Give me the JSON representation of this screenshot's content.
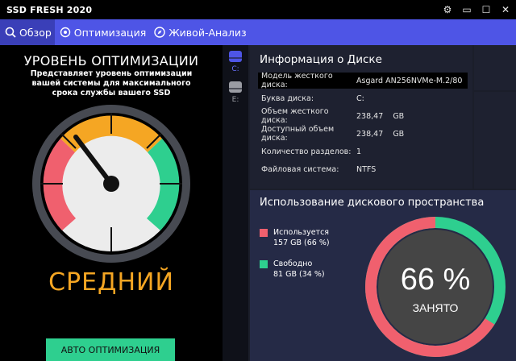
{
  "app": {
    "title": "SSD FRESH 2020"
  },
  "tabs": [
    {
      "label": "Обзор",
      "icon": "search-icon",
      "active": true
    },
    {
      "label": "Оптимизация",
      "icon": "gear-icon",
      "active": false
    },
    {
      "label": "Живой-Анализ",
      "icon": "compass-icon",
      "active": false
    }
  ],
  "optimization": {
    "heading": "УРОВЕНЬ ОПТИМИЗАЦИИ",
    "description": "Представляет уровень оптимизации вашей системы для максимального срока службы вашего SSD",
    "level": "СРЕДНИЙ",
    "button": "АВТО ОПТИМИЗАЦИЯ"
  },
  "drives": [
    {
      "letter": "C:",
      "selected": true
    },
    {
      "letter": "E:",
      "selected": false
    }
  ],
  "disk_info": {
    "heading": "Информация о Диске",
    "rows": [
      {
        "key": "Модель жесткого диска:",
        "value": "Asgard AN256NVMe-M.2/80"
      },
      {
        "key": "Буква диска:",
        "value": "C:"
      },
      {
        "key": "Объем жесткого диска:",
        "value": "238,47    GB"
      },
      {
        "key": "Доступный объем диска:",
        "value": "238,47    GB"
      },
      {
        "key": "Количество разделов:",
        "value": "1"
      },
      {
        "key": "Файловая система:",
        "value": "NTFS"
      }
    ]
  },
  "usage": {
    "heading": "Использование дискового пространства",
    "used_label": "Используется",
    "used_value": "157 GB (66 %)",
    "free_label": "Свободно",
    "free_value": "81 GB (34 %)",
    "percent_text": "66 %",
    "status_text": "ЗАНЯТО",
    "used_fraction": 0.66,
    "colors": {
      "used": "#f0606e",
      "free": "#2ecf8f"
    }
  },
  "colors": {
    "accent": "#4e55e6",
    "level": "#f5a623",
    "button": "#2ecf8f"
  }
}
